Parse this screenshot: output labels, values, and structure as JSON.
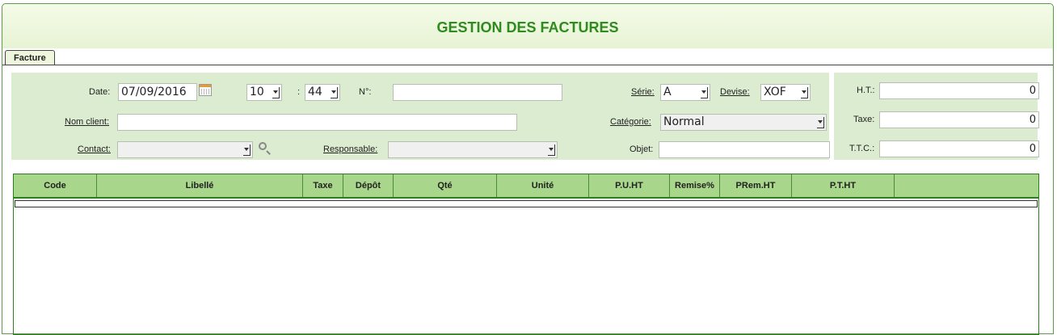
{
  "title": "GESTION DES FACTURES",
  "tab": {
    "label": "Facture"
  },
  "form": {
    "date_label": "Date:",
    "date_value": "07/09/2016",
    "hour_value": "10",
    "colon": ":",
    "minute_value": "44",
    "numero_label": "N°:",
    "numero_value": "",
    "serie_label": "Série:",
    "serie_value": "A",
    "devise_label": "Devise:",
    "devise_value": "XOF",
    "nom_client_label": "Nom client:",
    "nom_client_value": "",
    "categorie_label": "Catégorie:",
    "categorie_value": "Normal",
    "contact_label": "Contact:",
    "contact_value": "",
    "responsable_label": "Responsable:",
    "responsable_value": "",
    "objet_label": "Objet:",
    "objet_value": ""
  },
  "totals": {
    "ht_label": "H.T.:",
    "ht_value": "0",
    "taxe_label": "Taxe:",
    "taxe_value": "0",
    "ttc_label": "T.T.C.:",
    "ttc_value": "0"
  },
  "grid": {
    "columns": [
      "Code",
      "Libellé",
      "Taxe",
      "Dépôt",
      "Qté",
      "Unité",
      "P.U.HT",
      "Remise%",
      "PRem.HT",
      "P.T.HT",
      ""
    ]
  },
  "icons": {
    "calendar": "calendar-icon",
    "search": "search-icon",
    "dropdown": "chevron-down-icon"
  },
  "colors": {
    "title": "#2e8b1e",
    "panel": "#dcecd0",
    "grid_header": "#a8d68a",
    "border": "#2e7d1e"
  }
}
